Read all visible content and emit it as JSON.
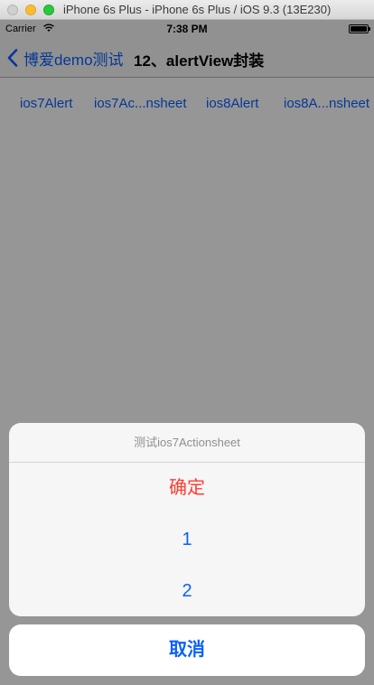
{
  "window": {
    "title": "iPhone 6s Plus - iPhone 6s Plus / iOS 9.3 (13E230)"
  },
  "status_bar": {
    "carrier": "Carrier",
    "time": "7:38 PM"
  },
  "nav": {
    "back_label": "博爱demo测试",
    "title": "12、alertView封装"
  },
  "buttons": [
    "ios7Alert",
    "ios7Ac...nsheet",
    "ios8Alert",
    "ios8A...nsheet"
  ],
  "action_sheet": {
    "title": "测试ios7Actionsheet",
    "destructive": "确定",
    "options": [
      "1",
      "2"
    ],
    "cancel": "取消"
  },
  "colors": {
    "tint": "#0a60ff",
    "destructive": "#ff3b30",
    "sheet_background": "#f6f6f6"
  },
  "icons": [
    "back-chevron-icon",
    "wifi-icon",
    "battery-icon"
  ]
}
